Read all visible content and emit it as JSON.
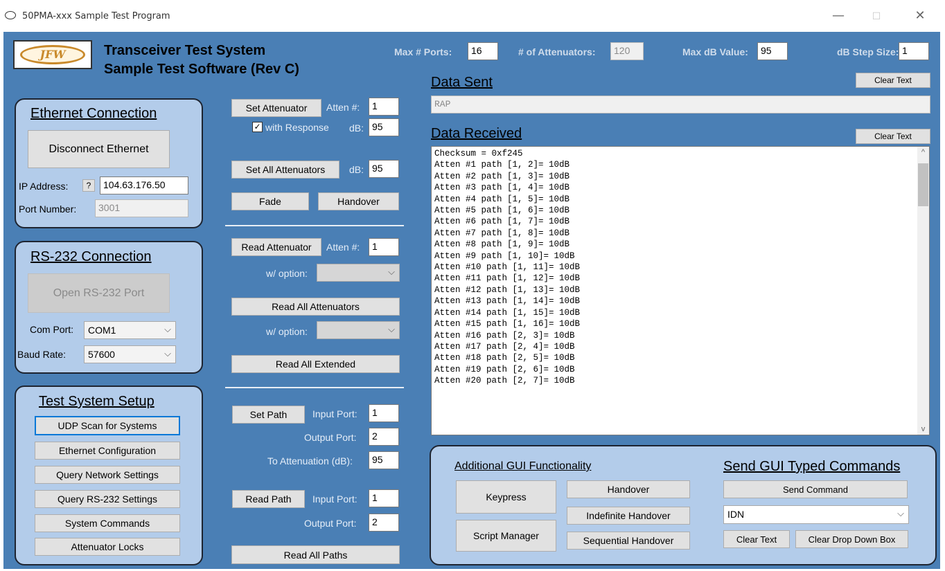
{
  "window": {
    "title": "50PMA-xxx Sample Test Program",
    "controls": {
      "minimize": "—",
      "maximize": "☐",
      "close": "✕"
    }
  },
  "header": {
    "logo_text": "JFW",
    "title_line1": "Transceiver Test System",
    "title_line2": "Sample Test Software (Rev C)",
    "max_ports_label": "Max # Ports:",
    "max_ports_value": "16",
    "num_attenuators_label": "# of Attenuators:",
    "num_attenuators_value": "120",
    "max_db_label": "Max dB Value:",
    "max_db_value": "95",
    "db_step_label": "dB Step Size:",
    "db_step_value": "1"
  },
  "ethernet": {
    "title": "Ethernet Connection",
    "disconnect_label": "Disconnect Ethernet",
    "ip_label": "IP Address:",
    "ip_help": "?",
    "ip_value": "104.63.176.50",
    "port_label": "Port Number:",
    "port_value": "3001"
  },
  "rs232": {
    "title": "RS-232 Connection",
    "open_label": "Open RS-232 Port",
    "com_label": "Com Port:",
    "com_value": "COM1",
    "baud_label": "Baud Rate:",
    "baud_value": "57600"
  },
  "setup": {
    "title": "Test System Setup",
    "buttons": [
      "UDP Scan for Systems",
      "Ethernet Configuration",
      "Query Network Settings",
      "Query RS-232 Settings",
      "System Commands",
      "Attenuator Locks"
    ]
  },
  "controls": {
    "set_attenuator": "Set Attenuator",
    "atten_num_label": "Atten #:",
    "atten_num_value": "1",
    "with_response_check": "✓",
    "with_response_label": "with Response",
    "db_label": "dB:",
    "db_value": "95",
    "set_all_attenuators": "Set All Attenuators",
    "set_all_db_label": "dB:",
    "set_all_db_value": "95",
    "fade": "Fade",
    "handover": "Handover",
    "read_attenuator": "Read Attenuator",
    "read_atten_num_label": "Atten #:",
    "read_atten_num_value": "1",
    "option_label": "w/ option:",
    "read_all_attenuators": "Read All Attenuators",
    "option_label2": "w/ option:",
    "read_all_extended": "Read All Extended",
    "set_path": "Set Path",
    "input_port_label": "Input Port:",
    "input_port_value": "1",
    "output_port_label": "Output Port:",
    "output_port_value": "2",
    "to_attenuation_label": "To Attenuation (dB):",
    "to_attenuation_value": "95",
    "read_path": "Read Path",
    "read_input_port_label": "Input Port:",
    "read_input_port_value": "1",
    "read_output_port_label": "Output Port:",
    "read_output_port_value": "2",
    "read_all_paths": "Read All Paths"
  },
  "data_sent": {
    "title": "Data Sent",
    "clear_label": "Clear Text",
    "value": "RAP"
  },
  "data_received": {
    "title": "Data Received",
    "clear_label": "Clear Text",
    "lines": [
      "Checksum = 0xf245",
      "Atten #1 path [1, 2]= 10dB",
      "Atten #2 path [1, 3]= 10dB",
      "Atten #3 path [1, 4]= 10dB",
      "Atten #4 path [1, 5]= 10dB",
      "Atten #5 path [1, 6]= 10dB",
      "Atten #6 path [1, 7]= 10dB",
      "Atten #7 path [1, 8]= 10dB",
      "Atten #8 path [1, 9]= 10dB",
      "Atten #9 path [1, 10]= 10dB",
      "Atten #10 path [1, 11]= 10dB",
      "Atten #11 path [1, 12]= 10dB",
      "Atten #12 path [1, 13]= 10dB",
      "Atten #13 path [1, 14]= 10dB",
      "Atten #14 path [1, 15]= 10dB",
      "Atten #15 path [1, 16]= 10dB",
      "Atten #16 path [2, 3]= 10dB",
      "Atten #17 path [2, 4]= 10dB",
      "Atten #18 path [2, 5]= 10dB",
      "Atten #19 path [2, 6]= 10dB",
      "Atten #20 path [2, 7]= 10dB"
    ]
  },
  "additional": {
    "title": "Additional GUI Functionality",
    "keypress": "Keypress",
    "script_manager": "Script Manager",
    "handover": "Handover",
    "indefinite_handover": "Indefinite Handover",
    "sequential_handover": "Sequential Handover"
  },
  "typed": {
    "title": "Send GUI Typed Commands",
    "send_command": "Send Command",
    "command_value": "IDN",
    "clear_text": "Clear Text",
    "clear_dropdown": "Clear Drop Down Box"
  }
}
